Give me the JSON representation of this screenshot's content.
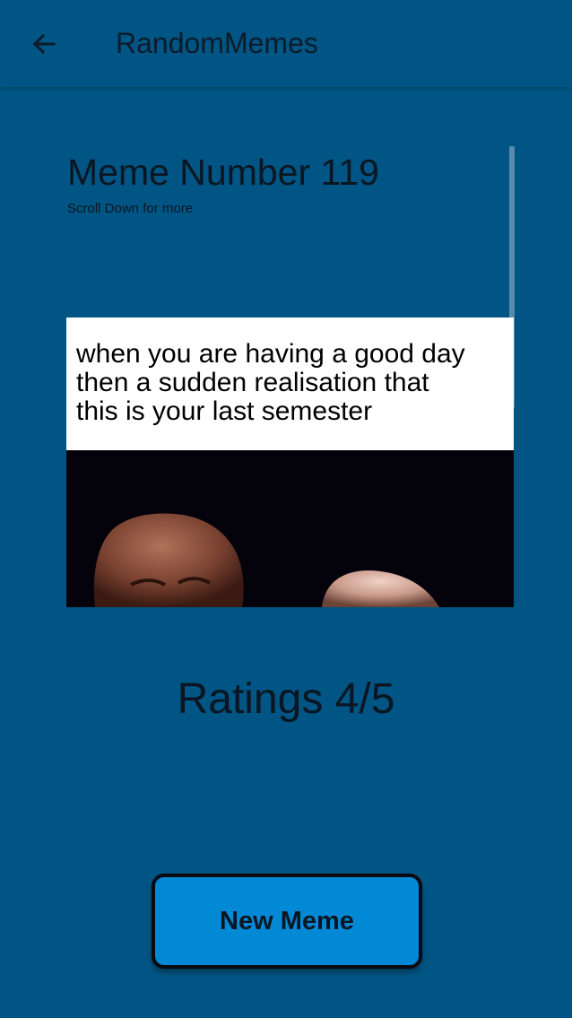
{
  "app_bar": {
    "title": "RandomMemes",
    "back_icon": "arrow-left-icon"
  },
  "meme": {
    "title": "Meme Number 119",
    "subtitle": "Scroll Down for more",
    "caption_lines": [
      "when you are having a good day",
      "then a sudden realisation that",
      "this is your last semester"
    ]
  },
  "ratings_label": "Ratings 4/5",
  "new_meme_button": "New Meme",
  "colors": {
    "background": "#005584",
    "button": "#0289d6",
    "text": "#0b1622"
  }
}
